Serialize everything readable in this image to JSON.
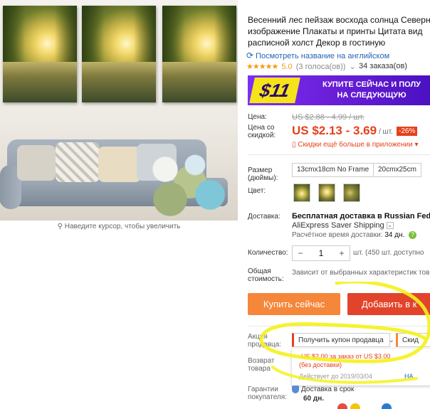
{
  "gallery": {
    "zoom_hint": "Наведите курсор, чтобы увеличить",
    "panels": 3
  },
  "product": {
    "title": "Весенний лес пейзаж восхода солнца Северн изображение Плакаты и принты Цитата вид расписной холст Декор в гостиную",
    "translate_link": "Посмотреть название на английском",
    "rating": "5.0",
    "votes": "(3 голоса(ов))",
    "orders": "34 заказа(ов)"
  },
  "banner": {
    "amount": "$11",
    "text_line1": "КУПИТЕ СЕЙЧАС И ПОЛУ",
    "text_line2": "НА СЛЕДУЮЩУЮ"
  },
  "pricing": {
    "price_label": "Цена:",
    "old_price": "US $2.88 - 4.99 / шт.",
    "discount_label_line1": "Цена со",
    "discount_label_line2": "скидкой:",
    "price": "US $2.13 - 3.69",
    "unit": "/ шт.",
    "discount_badge": "-26%",
    "app_promo": "Скидки ещё больше в приложении"
  },
  "options": {
    "size_label_line1": "Размер",
    "size_label_line2": "(дюймы):",
    "sizes": [
      "13cmx18cm No Frame",
      "20cmx25cm"
    ],
    "color_label": "Цвет:"
  },
  "shipping": {
    "label": "Доставка:",
    "title": "Бесплатная доставка в Russian Federa",
    "method": "AliExpress Saver Shipping",
    "time_label": "Расчётное время доставки:",
    "time_value": "34 дн."
  },
  "quantity": {
    "label": "Количество:",
    "minus": "−",
    "value": "1",
    "plus": "+",
    "note": "шт. (450 шт. доступно"
  },
  "total": {
    "label_line1": "Общая",
    "label_line2": "стоимость:",
    "note": "Зависит от выбранных характеристик тов"
  },
  "actions": {
    "buy_now": "Купить сейчас",
    "add_to_cart": "Добавить в к"
  },
  "promo": {
    "label_line1": "Акция",
    "label_line2": "продавца:",
    "coupon_button": "Получить купон продавца",
    "coupon_button2": "Скид",
    "coupon_line1": "-US $2.00 за заказ от US $3.00",
    "coupon_line2": "(без доставки)",
    "coupon_valid": "Действует до 2019/03/04",
    "coupon_get": "НА"
  },
  "returns": {
    "label_line1": "Возврат",
    "label_line2": "товара"
  },
  "guarantee": {
    "label_line1": "Гарантии",
    "label_line2": "покупателя:",
    "text": "Доставка в срок",
    "days": "60 дн."
  },
  "colors": {
    "accent": "#e6401b",
    "buy_now": "#f5873b",
    "add_to_cart": "#e2442b",
    "link": "#2563b8",
    "marker": "#f4f21a"
  }
}
